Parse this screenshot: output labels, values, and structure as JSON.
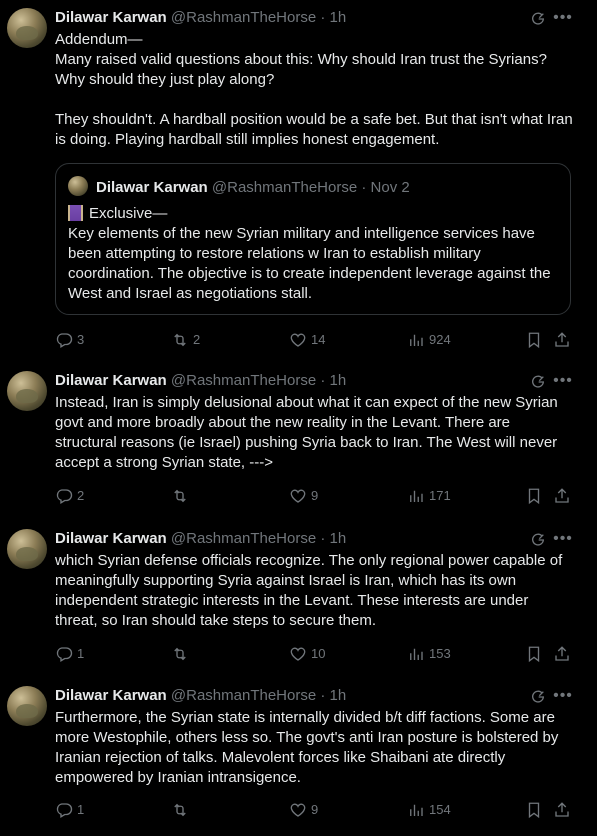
{
  "posts": [
    {
      "author": "Dilawar Karwan",
      "handle": "@RashmanTheHorse",
      "time": "1h",
      "text": "Addendum—\nMany raised valid questions about this: Why should Iran trust the Syrians? Why should they just play along?\n\nThey shouldn't. A hardball position would be a safe bet. But that isn't what Iran is doing. Playing hardball still implies honest engagement.",
      "quote": {
        "author": "Dilawar Karwan",
        "handle": "@RashmanTheHorse",
        "time": "Nov 2",
        "first_line": "Exclusive—",
        "text": "Key elements of the new Syrian military and intelligence services have been attempting to restore relations w Iran to establish military coordination. The objective is to create independent leverage against the West and Israel as negotiations stall."
      },
      "replies": "3",
      "reposts": "2",
      "likes": "14",
      "views": "924"
    },
    {
      "author": "Dilawar Karwan",
      "handle": "@RashmanTheHorse",
      "time": "1h",
      "text": "Instead, Iran is simply delusional about what it can expect of the new Syrian govt and more broadly about the new reality in the Levant. There are structural reasons (ie Israel) pushing Syria back to Iran. The West will never accept a strong Syrian state, --->",
      "replies": "2",
      "reposts": "",
      "likes": "9",
      "views": "171"
    },
    {
      "author": "Dilawar Karwan",
      "handle": "@RashmanTheHorse",
      "time": "1h",
      "text": "which Syrian defense officials recognize. The only regional power capable of meaningfully supporting Syria against Israel is Iran, which has its own independent strategic interests in the Levant. These interests are under threat, so Iran should take steps to secure them.",
      "replies": "1",
      "reposts": "",
      "likes": "10",
      "views": "153"
    },
    {
      "author": "Dilawar Karwan",
      "handle": "@RashmanTheHorse",
      "time": "1h",
      "text": "Furthermore, the Syrian state is internally divided b/t diff factions. Some are more Westophile, others less so. The govt's anti Iran posture is bolstered by Iranian rejection of talks. Malevolent forces like Shaibani ate directly empowered by Iranian intransigence.",
      "replies": "1",
      "reposts": "",
      "likes": "9",
      "views": "154"
    }
  ],
  "separator": "·",
  "icons": {
    "reply": "reply-icon",
    "repost": "repost-icon",
    "like": "heart-icon",
    "views": "views-icon",
    "bookmark": "bookmark-icon",
    "share": "share-icon",
    "grok": "grok-icon",
    "more": "more-icon"
  },
  "colors": {
    "background": "#000000",
    "text": "#e7e9ea",
    "muted": "#71767b",
    "border": "#2f3336"
  }
}
